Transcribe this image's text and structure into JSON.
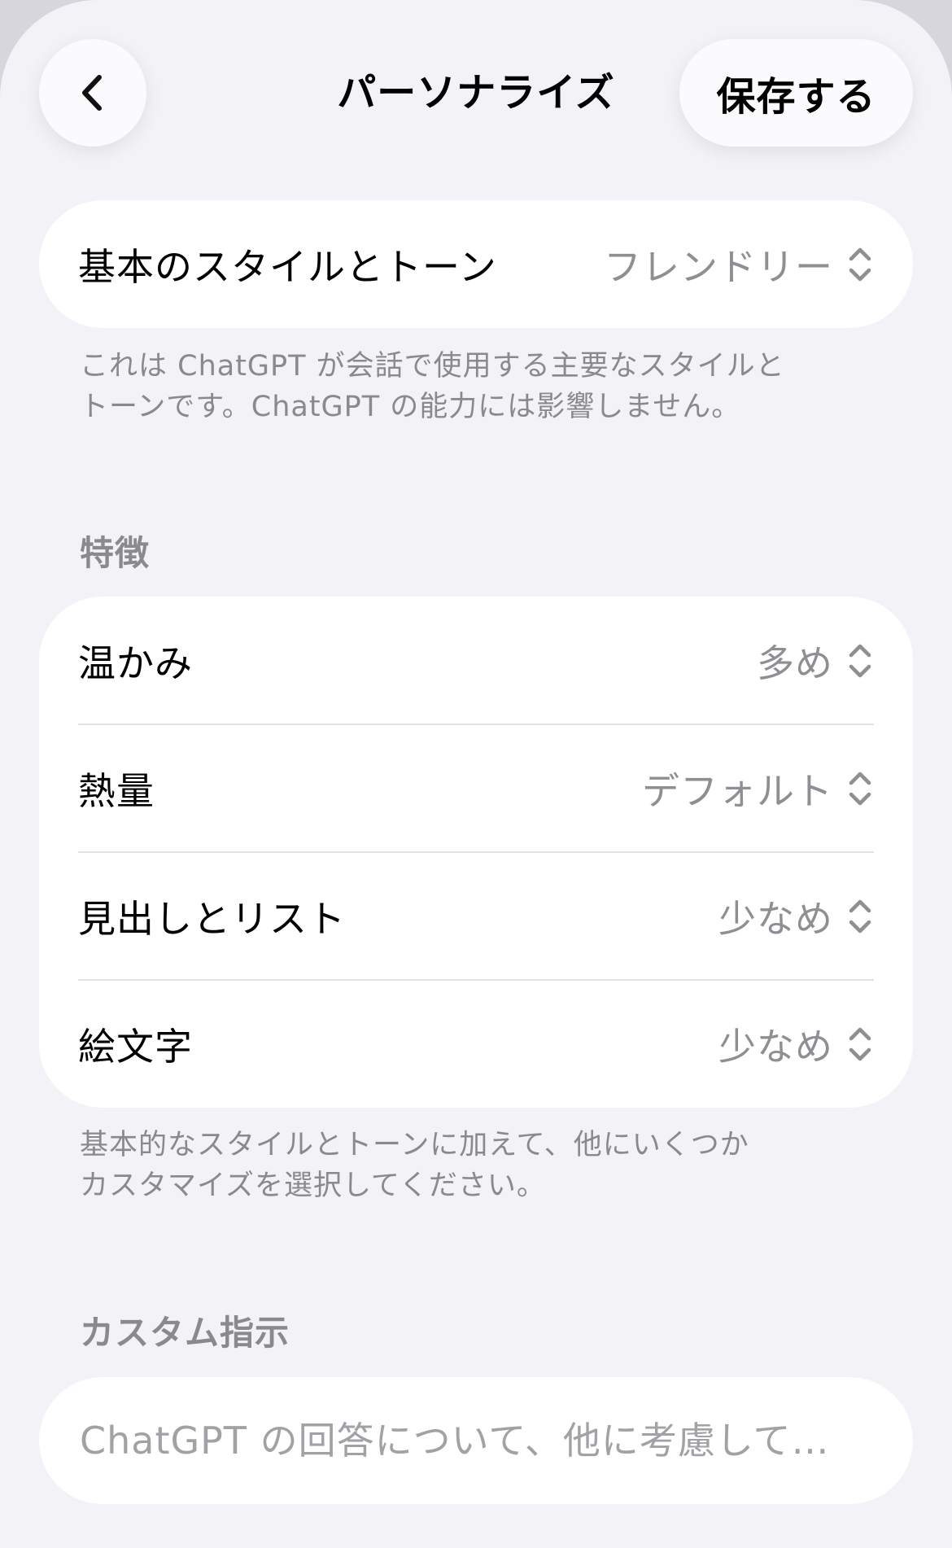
{
  "header": {
    "title": "パーソナライズ",
    "save_label": "保存する",
    "back_icon": "chevron-left-icon"
  },
  "style_tone": {
    "label": "基本のスタイルとトーン",
    "value": "フレンドリー",
    "note_lines": [
      "これは ChatGPT が会話で使用する主要なスタイルと",
      "トーンです。ChatGPT の能力には影響しません。"
    ]
  },
  "traits": {
    "heading": "特徴",
    "items": [
      {
        "label": "温かみ",
        "value": "多め"
      },
      {
        "label": "熱量",
        "value": "デフォルト"
      },
      {
        "label": "見出しとリスト",
        "value": "少なめ"
      },
      {
        "label": "絵文字",
        "value": "少なめ"
      }
    ],
    "note_lines": [
      "基本的なスタイルとトーンに加えて、他にいくつか",
      "カスタマイズを選択してください。"
    ]
  },
  "custom_instructions": {
    "heading": "カスタム指示",
    "placeholder": "ChatGPT の回答について、他に考慮して…"
  },
  "colors": {
    "background": "#f2f2f7",
    "card": "#ffffff",
    "secondary_text": "#8e8e93"
  },
  "icons": {
    "selector": "chevron-up-down-icon"
  }
}
